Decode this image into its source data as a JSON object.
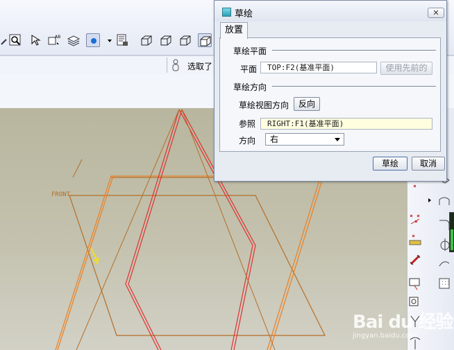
{
  "toolbar": {
    "select_label": "选取了"
  },
  "viewport": {
    "datum_label": "FRONT",
    "colors": {
      "datum": "#b46e28",
      "sketch": "#e8842c",
      "highlight": "#e03030",
      "arrow": "#f0e020"
    }
  },
  "dialog": {
    "title": "草绘",
    "close_symbol": "✕",
    "tab": "放置",
    "sketch_plane": {
      "section_label": "草绘平面",
      "plane_label": "平面",
      "plane_value": "TOP:F2(基准平面)",
      "use_previous_button": "使用先前的"
    },
    "sketch_orientation": {
      "section_label": "草绘方向",
      "view_direction_label": "草绘视图方向",
      "flip_button": "反向",
      "reference_label": "参照",
      "reference_value": "RIGHT:F1(基准平面)",
      "orientation_label": "方向",
      "orientation_value": "右"
    },
    "ok_button": "草绘",
    "cancel_button": "取消"
  },
  "watermark": {
    "brand": "Bai du 经验",
    "url": "jingyan.baidu.com"
  }
}
